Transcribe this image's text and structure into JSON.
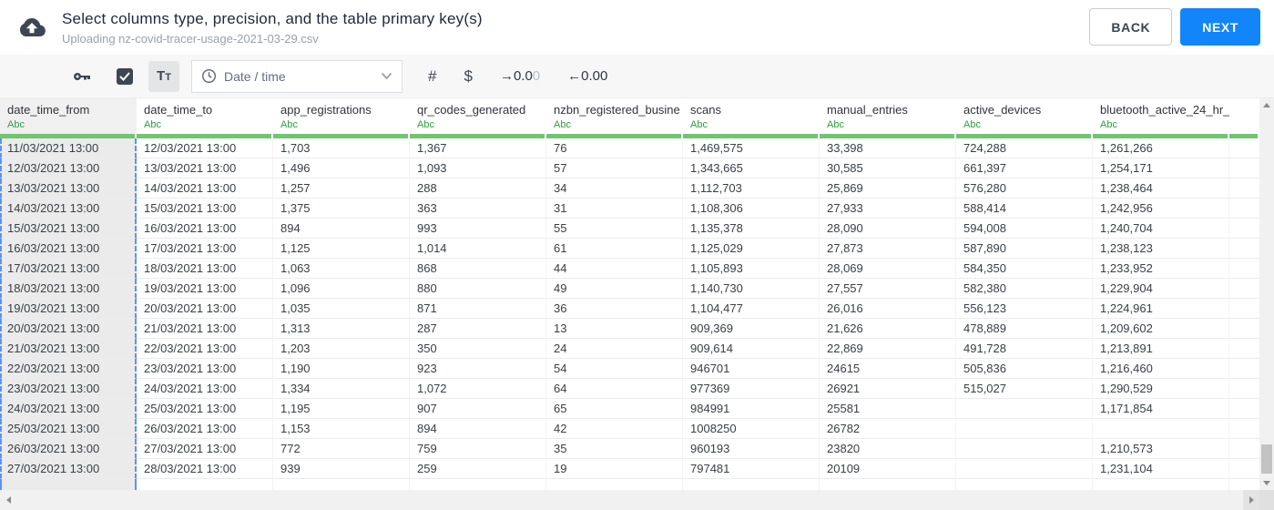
{
  "header": {
    "title": "Select columns type, precision, and the table primary key(s)",
    "subtitle": "Uploading nz-covid-tracer-usage-2021-03-29.csv",
    "back_label": "BACK",
    "next_label": "NEXT"
  },
  "toolbar": {
    "text_format_label": "Tt",
    "type_select_value": "Date / time",
    "hash_label": "#",
    "dollar_label": "$",
    "increase_decimal": {
      "dark": "→0.0",
      "light": "0"
    },
    "decrease_decimal": {
      "label": "←0.00"
    }
  },
  "table": {
    "type_label": "Abc",
    "selected_column_index": 0,
    "columns": [
      "date_time_from",
      "date_time_to",
      "app_registrations",
      "qr_codes_generated",
      "nzbn_registered_busine",
      "scans",
      "manual_entries",
      "active_devices",
      "bluetooth_active_24_hr_"
    ],
    "rows": [
      [
        "11/03/2021 13:00",
        "12/03/2021 13:00",
        "1,703",
        "1,367",
        "76",
        "1,469,575",
        "33,398",
        "724,288",
        "1,261,266"
      ],
      [
        "12/03/2021 13:00",
        "13/03/2021 13:00",
        "1,496",
        "1,093",
        "57",
        "1,343,665",
        "30,585",
        "661,397",
        "1,254,171"
      ],
      [
        "13/03/2021 13:00",
        "14/03/2021 13:00",
        "1,257",
        "288",
        "34",
        "1,112,703",
        "25,869",
        "576,280",
        "1,238,464"
      ],
      [
        "14/03/2021 13:00",
        "15/03/2021 13:00",
        "1,375",
        "363",
        "31",
        "1,108,306",
        "27,933",
        "588,414",
        "1,242,956"
      ],
      [
        "15/03/2021 13:00",
        "16/03/2021 13:00",
        "894",
        "993",
        "55",
        "1,135,378",
        "28,090",
        "594,008",
        "1,240,704"
      ],
      [
        "16/03/2021 13:00",
        "17/03/2021 13:00",
        "1,125",
        "1,014",
        "61",
        "1,125,029",
        "27,873",
        "587,890",
        "1,238,123"
      ],
      [
        "17/03/2021 13:00",
        "18/03/2021 13:00",
        "1,063",
        "868",
        "44",
        "1,105,893",
        "28,069",
        "584,350",
        "1,233,952"
      ],
      [
        "18/03/2021 13:00",
        "19/03/2021 13:00",
        "1,096",
        "880",
        "49",
        "1,140,730",
        "27,557",
        "582,380",
        "1,229,904"
      ],
      [
        "19/03/2021 13:00",
        "20/03/2021 13:00",
        "1,035",
        "871",
        "36",
        "1,104,477",
        "26,016",
        "556,123",
        "1,224,961"
      ],
      [
        "20/03/2021 13:00",
        "21/03/2021 13:00",
        "1,313",
        "287",
        "13",
        "909,369",
        "21,626",
        "478,889",
        "1,209,602"
      ],
      [
        "21/03/2021 13:00",
        "22/03/2021 13:00",
        "1,203",
        "350",
        "24",
        "909,614",
        "22,869",
        "491,728",
        "1,213,891"
      ],
      [
        "22/03/2021 13:00",
        "23/03/2021 13:00",
        "1,190",
        "923",
        "54",
        "946701",
        "24615",
        "505,836",
        "1,216,460"
      ],
      [
        "23/03/2021 13:00",
        "24/03/2021 13:00",
        "1,334",
        "1,072",
        "64",
        "977369",
        "26921",
        "515,027",
        "1,290,529"
      ],
      [
        "24/03/2021 13:00",
        "25/03/2021 13:00",
        "1,195",
        "907",
        "65",
        "984991",
        "25581",
        "",
        "1,171,854"
      ],
      [
        "25/03/2021 13:00",
        "26/03/2021 13:00",
        "1,153",
        "894",
        "42",
        "1008250",
        "26782",
        "",
        ""
      ],
      [
        "26/03/2021 13:00",
        "27/03/2021 13:00",
        "772",
        "759",
        "35",
        "960193",
        "23820",
        "",
        "1,210,573"
      ],
      [
        "27/03/2021 13:00",
        "28/03/2021 13:00",
        "939",
        "259",
        "19",
        "797481",
        "20109",
        "",
        "1,231,104"
      ]
    ]
  },
  "colors": {
    "accent_blue": "#1385fb",
    "selection_dash_blue": "#5b93f5",
    "type_green": "#2f9e3f",
    "header_bar_green": "#72c472",
    "dark_slate": "#3e4653"
  }
}
